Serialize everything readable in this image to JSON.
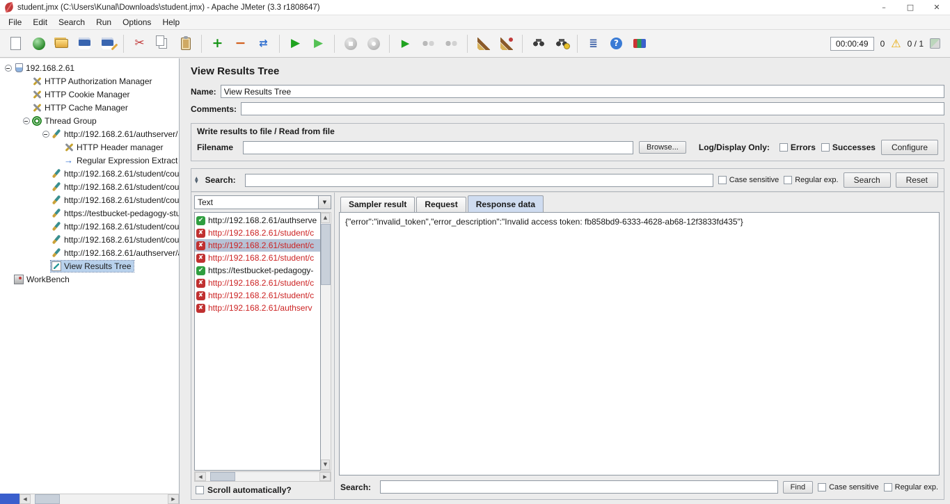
{
  "window": {
    "title": "student.jmx (C:\\Users\\Kunal\\Downloads\\student.jmx) - Apache JMeter (3.3 r1808647)",
    "controls": {
      "minimize": "–",
      "maximize": "□",
      "close": "✕"
    }
  },
  "menu": {
    "items": [
      "File",
      "Edit",
      "Search",
      "Run",
      "Options",
      "Help"
    ]
  },
  "toolbar": {
    "timer": "00:00:49",
    "error_count": "0",
    "warning_glyph": "⚠",
    "thread_count": "0 / 1",
    "items": [
      {
        "name": "new-file",
        "cls": "i-new",
        "glyph": ""
      },
      {
        "name": "templates",
        "cls": "i-tpl",
        "glyph": ""
      },
      {
        "name": "open-file",
        "cls": "i-open",
        "glyph": ""
      },
      {
        "name": "save",
        "cls": "i-save",
        "glyph": ""
      },
      {
        "name": "save-as",
        "cls": "i-saveas",
        "glyph": ""
      },
      {
        "sep": true
      },
      {
        "name": "cut",
        "cls": "i-cut",
        "glyph": "✂"
      },
      {
        "name": "copy",
        "cls": "i-copy",
        "glyph": ""
      },
      {
        "name": "paste",
        "cls": "i-paste",
        "glyph": ""
      },
      {
        "sep": true
      },
      {
        "name": "expand-all",
        "cls": "i-plus",
        "glyph": "+"
      },
      {
        "name": "collapse-all",
        "cls": "i-minus",
        "glyph": "−"
      },
      {
        "name": "toggle",
        "cls": "i-toggle",
        "glyph": "⇄"
      },
      {
        "sep": true
      },
      {
        "name": "start",
        "cls": "i-start",
        "glyph": "▶"
      },
      {
        "name": "start-no-pauses",
        "cls": "i-start2",
        "glyph": "▶"
      },
      {
        "sep": true
      },
      {
        "name": "stop",
        "cls": "i-stop",
        "glyph": ""
      },
      {
        "name": "shutdown",
        "cls": "i-shut",
        "glyph": ""
      },
      {
        "sep": true
      },
      {
        "name": "remote-start-all",
        "cls": "i-rstart",
        "glyph": "▶"
      },
      {
        "name": "remote-stop-all",
        "cls": "i-rstop",
        "glyph": ""
      },
      {
        "name": "remote-shutdown-all",
        "cls": "i-rshut",
        "glyph": ""
      },
      {
        "sep": true
      },
      {
        "name": "clear",
        "cls": "i-clear",
        "glyph": ""
      },
      {
        "name": "clear-all",
        "cls": "i-clearall",
        "glyph": ""
      },
      {
        "sep": true
      },
      {
        "name": "search",
        "cls": "i-bino",
        "glyph": ""
      },
      {
        "name": "search-reset",
        "cls": "i-binox",
        "glyph": ""
      },
      {
        "sep": true
      },
      {
        "name": "logger-panel-toggle",
        "cls": "i-list",
        "glyph": "≣"
      },
      {
        "name": "help",
        "cls": "i-help",
        "glyph": "?"
      },
      {
        "name": "function-helper",
        "cls": "i-fx",
        "glyph": ""
      }
    ]
  },
  "tree": {
    "items": [
      {
        "label": "192.168.2.61",
        "icon": "ic-plan",
        "iname": "test-plan-icon",
        "depth": "d0",
        "handle": true,
        "selected": false
      },
      {
        "label": "HTTP Authorization Manager",
        "icon": "ic-mgr",
        "iname": "http-auth-manager-icon",
        "depth": "d1",
        "handle": false,
        "selected": false
      },
      {
        "label": "HTTP Cookie Manager",
        "icon": "ic-mgr",
        "iname": "http-cookie-manager-icon",
        "depth": "d1",
        "handle": false,
        "selected": false
      },
      {
        "label": "HTTP Cache Manager",
        "icon": "ic-mgr",
        "iname": "http-cache-manager-icon",
        "depth": "d1",
        "handle": false,
        "selected": false
      },
      {
        "label": "Thread Group",
        "icon": "ic-tg",
        "iname": "thread-group-icon",
        "depth": "d1",
        "handle": true,
        "selected": false
      },
      {
        "label": "http://192.168.2.61/authserver/",
        "icon": "ic-smp",
        "iname": "http-sampler-icon",
        "depth": "d2",
        "handle": true,
        "selected": false
      },
      {
        "label": "HTTP Header manager",
        "icon": "ic-mgr",
        "iname": "http-header-manager-icon",
        "depth": "d3",
        "handle": false,
        "selected": false
      },
      {
        "label": "Regular Expression Extract",
        "icon": "ic-rex",
        "iname": "regex-extractor-icon",
        "depth": "d3",
        "handle": false,
        "selected": false
      },
      {
        "label": "http://192.168.2.61/student/cou",
        "icon": "ic-smp",
        "iname": "http-sampler-icon",
        "depth": "d2",
        "handle": false,
        "selected": false
      },
      {
        "label": "http://192.168.2.61/student/cou",
        "icon": "ic-smp",
        "iname": "http-sampler-icon",
        "depth": "d2",
        "handle": false,
        "selected": false
      },
      {
        "label": "http://192.168.2.61/student/cou",
        "icon": "ic-smp",
        "iname": "http-sampler-icon",
        "depth": "d2",
        "handle": false,
        "selected": false
      },
      {
        "label": "https://testbucket-pedagogy-stu",
        "icon": "ic-smp",
        "iname": "http-sampler-icon",
        "depth": "d2",
        "handle": false,
        "selected": false
      },
      {
        "label": "http://192.168.2.61/student/cou",
        "icon": "ic-smp",
        "iname": "http-sampler-icon",
        "depth": "d2",
        "handle": false,
        "selected": false
      },
      {
        "label": "http://192.168.2.61/student/cou",
        "icon": "ic-smp",
        "iname": "http-sampler-icon",
        "depth": "d2",
        "handle": false,
        "selected": false
      },
      {
        "label": "http://192.168.2.61/authserver/a",
        "icon": "ic-smp",
        "iname": "http-sampler-icon",
        "depth": "d2",
        "handle": false,
        "selected": false
      },
      {
        "label": "View Results Tree",
        "icon": "ic-vrt",
        "iname": "results-tree-icon",
        "depth": "d2",
        "handle": false,
        "selected": true
      },
      {
        "label": "WorkBench",
        "icon": "ic-wb",
        "iname": "workbench-icon",
        "depth": "d0",
        "handle": false,
        "selected": false
      }
    ]
  },
  "page": {
    "title": "View Results Tree"
  },
  "fields": {
    "name": {
      "label": "Name:",
      "value": "View Results Tree"
    },
    "comments": {
      "label": "Comments:",
      "value": ""
    }
  },
  "file": {
    "title": "Write results to file / Read from file",
    "filename_label": "Filename",
    "filename_value": "",
    "browse": "Browse...",
    "log_display": "Log/Display Only:",
    "errors": "Errors",
    "successes": "Successes",
    "configure": "Configure"
  },
  "search": {
    "label": "Search:",
    "value": "",
    "case_sensitive": "Case sensitive",
    "regex": "Regular exp.",
    "search_btn": "Search",
    "reset_btn": "Reset"
  },
  "results": {
    "view_mode": "Text",
    "ok_glyph": "✔",
    "err_glyph": "✘",
    "scroll_auto": "Scroll automatically?",
    "tabs": [
      "Sampler result",
      "Request",
      "Response data"
    ],
    "items": [
      {
        "label": "http://192.168.2.61/authserve",
        "status": "ok",
        "selected": false
      },
      {
        "label": "http://192.168.2.61/student/c",
        "status": "err",
        "selected": false
      },
      {
        "label": "http://192.168.2.61/student/c",
        "status": "err",
        "selected": true
      },
      {
        "label": "http://192.168.2.61/student/c",
        "status": "err",
        "selected": false
      },
      {
        "label": "https://testbucket-pedagogy-",
        "status": "ok",
        "selected": false
      },
      {
        "label": "http://192.168.2.61/student/c",
        "status": "err",
        "selected": false
      },
      {
        "label": "http://192.168.2.61/student/c",
        "status": "err",
        "selected": false
      },
      {
        "label": "http://192.168.2.61/authserv",
        "status": "err",
        "selected": false
      }
    ]
  },
  "response": {
    "text": "{\"error\":\"invalid_token\",\"error_description\":\"Invalid access token: fb858bd9-6333-4628-ab68-12f3833fd435\"}"
  },
  "find": {
    "label": "Search:",
    "value": "",
    "find_btn": "Find",
    "case_sensitive": "Case sensitive",
    "regex": "Regular exp."
  },
  "ui": {
    "up": "▲",
    "down": "▼",
    "left": "◀",
    "right": "▶"
  }
}
